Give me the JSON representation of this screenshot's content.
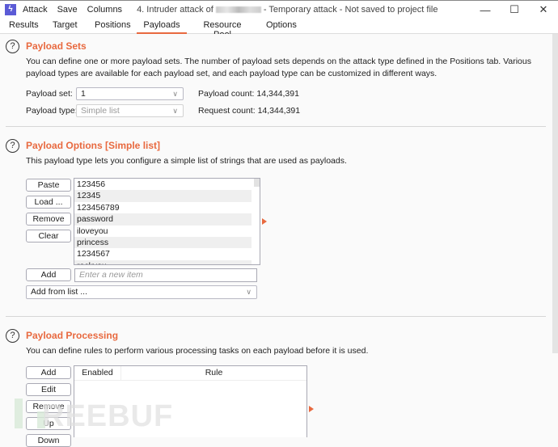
{
  "titlebar": {
    "app_icon": "burp-logo-icon",
    "menu": [
      "Attack",
      "Save",
      "Columns"
    ],
    "title_prefix": "4. Intruder attack of",
    "title_suffix": "- Temporary attack - Not saved to project file",
    "controls": {
      "minimize": "—",
      "maximize": "☐",
      "close": "✕"
    }
  },
  "tabs": [
    {
      "label": "Results",
      "active": false
    },
    {
      "label": "Target",
      "active": false
    },
    {
      "label": "Positions",
      "active": false
    },
    {
      "label": "Payloads",
      "active": true
    },
    {
      "label": "Resource Pool",
      "active": false
    },
    {
      "label": "Options",
      "active": false
    }
  ],
  "payload_sets": {
    "help_glyph": "?",
    "title": "Payload Sets",
    "description": "You can define one or more payload sets. The number of payload sets depends on the attack type defined in the Positions tab. Various payload types are available for each payload set, and each payload type can be customized in different ways.",
    "payload_set_label": "Payload set:",
    "payload_set_value": "1",
    "payload_type_label": "Payload type:",
    "payload_type_value": "Simple list",
    "payload_count_label": "Payload count:",
    "payload_count": "14,344,391",
    "request_count_label": "Request count:",
    "request_count": "14,344,391"
  },
  "payload_options": {
    "help_glyph": "?",
    "title": "Payload Options [Simple list]",
    "description": "This payload type lets you configure a simple list of strings that are used as payloads.",
    "buttons": {
      "paste": "Paste",
      "load": "Load ...",
      "remove": "Remove",
      "clear": "Clear",
      "add": "Add"
    },
    "items": [
      "123456",
      "12345",
      "123456789",
      "password",
      "iloveyou",
      "princess",
      "1234567",
      "rockyou"
    ],
    "new_item_placeholder": "Enter a new item",
    "add_from_list": "Add from list ..."
  },
  "payload_processing": {
    "help_glyph": "?",
    "title": "Payload Processing",
    "description": "You can define rules to perform various processing tasks on each payload before it is used.",
    "buttons": {
      "add": "Add",
      "edit": "Edit",
      "remove": "Remove",
      "up": "Up",
      "down": "Down"
    },
    "columns": [
      "Enabled",
      "Rule"
    ]
  },
  "watermark": "FREEBUF",
  "colors": {
    "accent": "#e8693f",
    "app_icon": "#5b5bd6"
  }
}
